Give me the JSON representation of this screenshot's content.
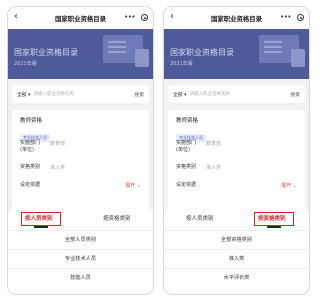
{
  "nav": {
    "back_icon": "‹",
    "title": "国家职业资格目录",
    "more_icon": "•••"
  },
  "banner": {
    "title": "国家职业资格目录",
    "subtitle": "2021年版"
  },
  "filter": {
    "category": "全部 ▾",
    "search_placeholder": "请输入职业资格名称",
    "search_button": "搜索"
  },
  "card": {
    "title": "教师资格",
    "tag": "专业技术人员",
    "rows": [
      {
        "label": "实施部门\n(单位)",
        "value": "教育部"
      },
      {
        "label": "资格类别",
        "value": "准入类"
      },
      {
        "label": "设定依据",
        "value": "",
        "expand": "展开 ⌄"
      }
    ]
  },
  "left_sheet": {
    "tabs": [
      "按人员类别",
      "按资格类别"
    ],
    "active_tab": 0,
    "options": [
      "全部人员类别",
      "专业技术人员",
      "技能人员"
    ]
  },
  "right_sheet": {
    "tabs": [
      "按人员类别",
      "按资格类别"
    ],
    "active_tab": 1,
    "options": [
      "全部资格类别",
      "准入类",
      "水平评价类"
    ]
  }
}
